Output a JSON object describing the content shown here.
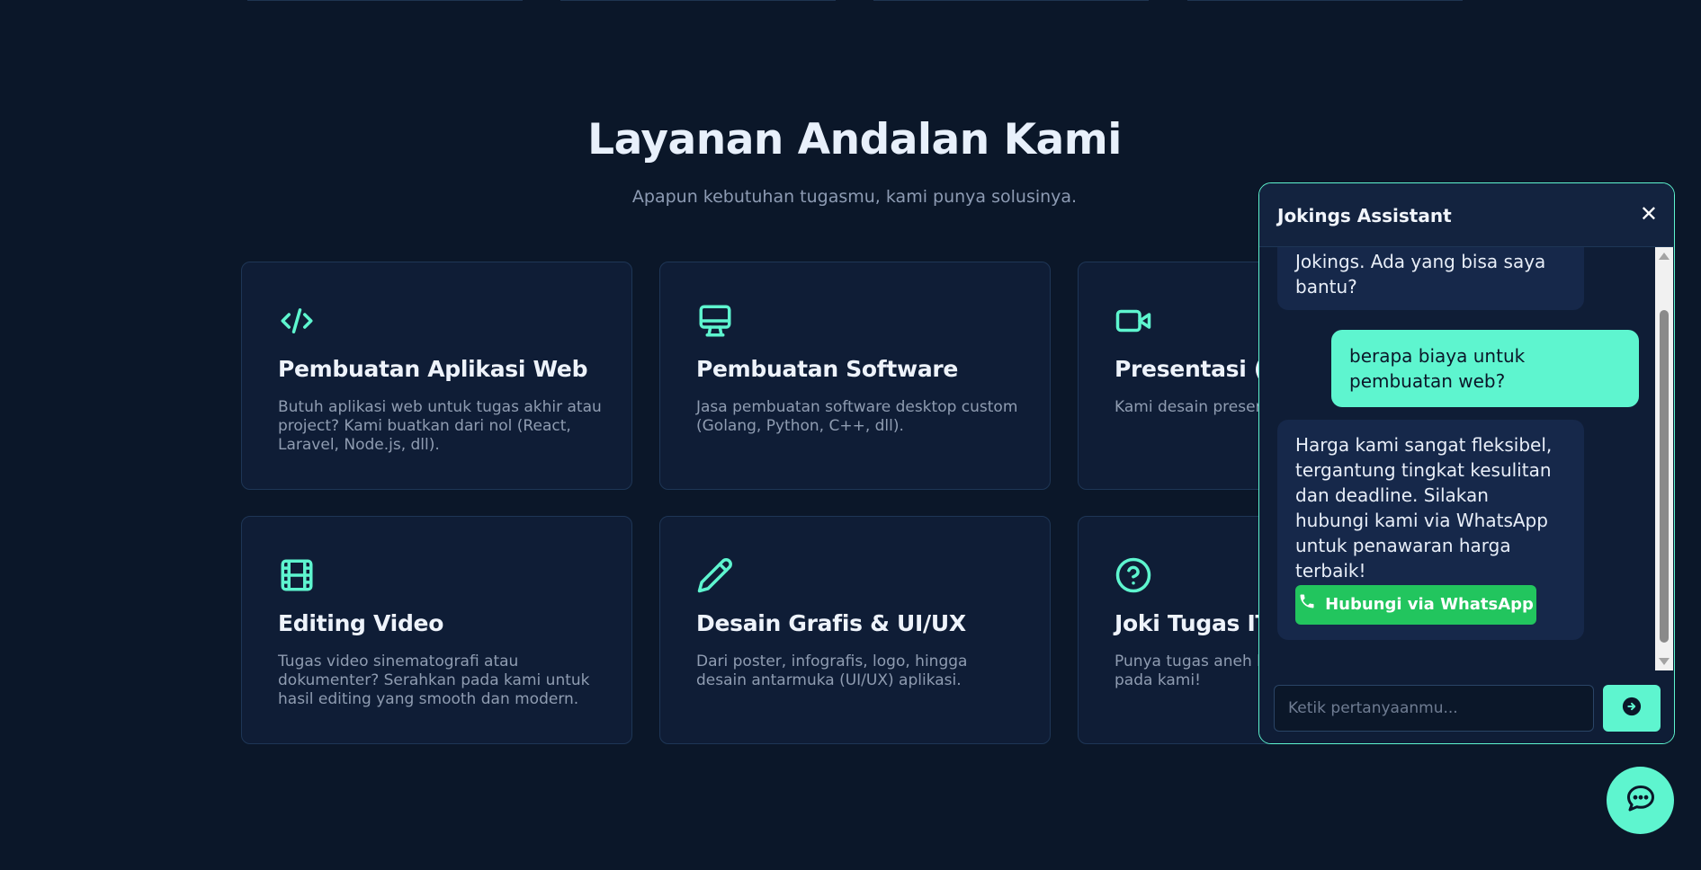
{
  "section": {
    "title": "Layanan Andalan Kami",
    "subtitle": "Apapun kebutuhan tugasmu, kami punya solusinya."
  },
  "services": [
    {
      "icon": "code-icon",
      "title": "Pembuatan Aplikasi Web",
      "desc": "Butuh aplikasi web untuk tugas akhir atau project? Kami buatkan dari nol (React, Laravel, Node.js, dll)."
    },
    {
      "icon": "monitor-icon",
      "title": "Pembuatan Software",
      "desc": "Jasa pembuatan software desktop custom (Golang, Python, C++, dll)."
    },
    {
      "icon": "video-camera-icon",
      "title": "Presentasi (I",
      "desc": "Kami desain presen memukau, informat"
    },
    {
      "icon": "film-icon",
      "title": "Editing Video",
      "desc": "Tugas video sinematografi atau dokumenter? Serahkan pada kami untuk hasil editing yang smooth dan modern."
    },
    {
      "icon": "pencil-icon",
      "title": "Desain Grafis & UI/UX",
      "desc": "Dari poster, infografis, logo, hingga desain antarmuka (UI/UX) aplikasi."
    },
    {
      "icon": "question-circle-icon",
      "title": "Joki Tugas IT",
      "desc": "Punya tugas aneh la data, atau apa pun pada kami!"
    }
  ],
  "chat": {
    "title": "Jokings Assistant",
    "close_label": "✕",
    "messages": [
      {
        "from": "bot",
        "text": "Jokings. Ada yang bisa saya bantu?"
      },
      {
        "from": "user",
        "text": "berapa biaya untuk pembuatan web?"
      },
      {
        "from": "bot",
        "text": "Harga kami sangat fleksibel, tergantung tingkat kesulitan dan deadline. Silakan hubungi kami via WhatsApp untuk penawaran harga terbaik!"
      }
    ],
    "whatsapp_label": "Hubungi via WhatsApp",
    "input_placeholder": "Ketik pertanyaanmu...",
    "send_icon": "arrow-right-circle-icon"
  },
  "fab_icon": "chat-bubble-icon",
  "colors": {
    "background": "#0b1729",
    "card": "#0f1d36",
    "accent": "#5ef5cf",
    "whatsapp": "#22c55e"
  }
}
